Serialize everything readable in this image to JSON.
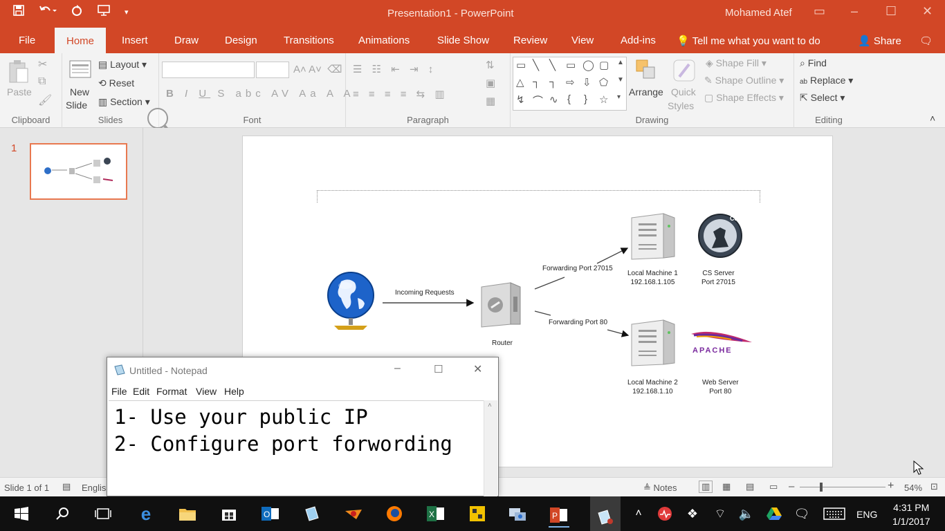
{
  "window": {
    "title": "Presentation1 - PowerPoint",
    "user": "Mohamed Atef"
  },
  "tabs": [
    "File",
    "Home",
    "Insert",
    "Draw",
    "Design",
    "Transitions",
    "Animations",
    "Slide Show",
    "Review",
    "View",
    "Add-ins"
  ],
  "tell_me": "Tell me what you want to do",
  "share": "Share",
  "ribbon": {
    "clipboard": {
      "label": "Clipboard",
      "paste": "Paste"
    },
    "slides": {
      "label": "Slides",
      "new_slide_1": "New",
      "new_slide_2": "Slide",
      "layout": "Layout",
      "reset": "Reset",
      "section": "Section"
    },
    "font": {
      "label": "Font"
    },
    "paragraph": {
      "label": "Paragraph"
    },
    "drawing": {
      "label": "Drawing",
      "arrange": "Arrange",
      "quick_styles_1": "Quick",
      "quick_styles_2": "Styles",
      "shape_fill": "Shape Fill",
      "shape_outline": "Shape Outline",
      "shape_effects": "Shape Effects"
    },
    "editing": {
      "label": "Editing",
      "find": "Find",
      "replace": "Replace",
      "select": "Select"
    }
  },
  "slide_panel": {
    "number": "1"
  },
  "diagram": {
    "incoming": "Incoming Requests",
    "router": "Router",
    "fwd1": "Forwarding Port 27015",
    "fwd2": "Forwarding Port 80",
    "m1_name": "Local Machine 1",
    "m1_ip": "192.168.1.105",
    "m2_name": "Local Machine 2",
    "m2_ip": "192.168.1.10",
    "cs_name": "CS Server",
    "cs_port": "Port 27015",
    "web_name": "Web Server",
    "web_port": "Port 80",
    "cs_logo": "CS",
    "apache_logo": "APACHE"
  },
  "status": {
    "slide": "Slide 1 of 1",
    "lang": "Englis",
    "notes": "Notes",
    "zoom": "54%"
  },
  "notepad": {
    "title": "Untitled - Notepad",
    "menu": [
      "File",
      "Edit",
      "Format",
      "View",
      "Help"
    ],
    "line1": "1- Use your public IP",
    "line2": "2- Configure port forwording"
  },
  "taskbar": {
    "lang": "ENG",
    "time": "4:31 PM",
    "date": "1/1/2017"
  },
  "colors": {
    "accent": "#d24726",
    "taskbar": "#101010"
  }
}
